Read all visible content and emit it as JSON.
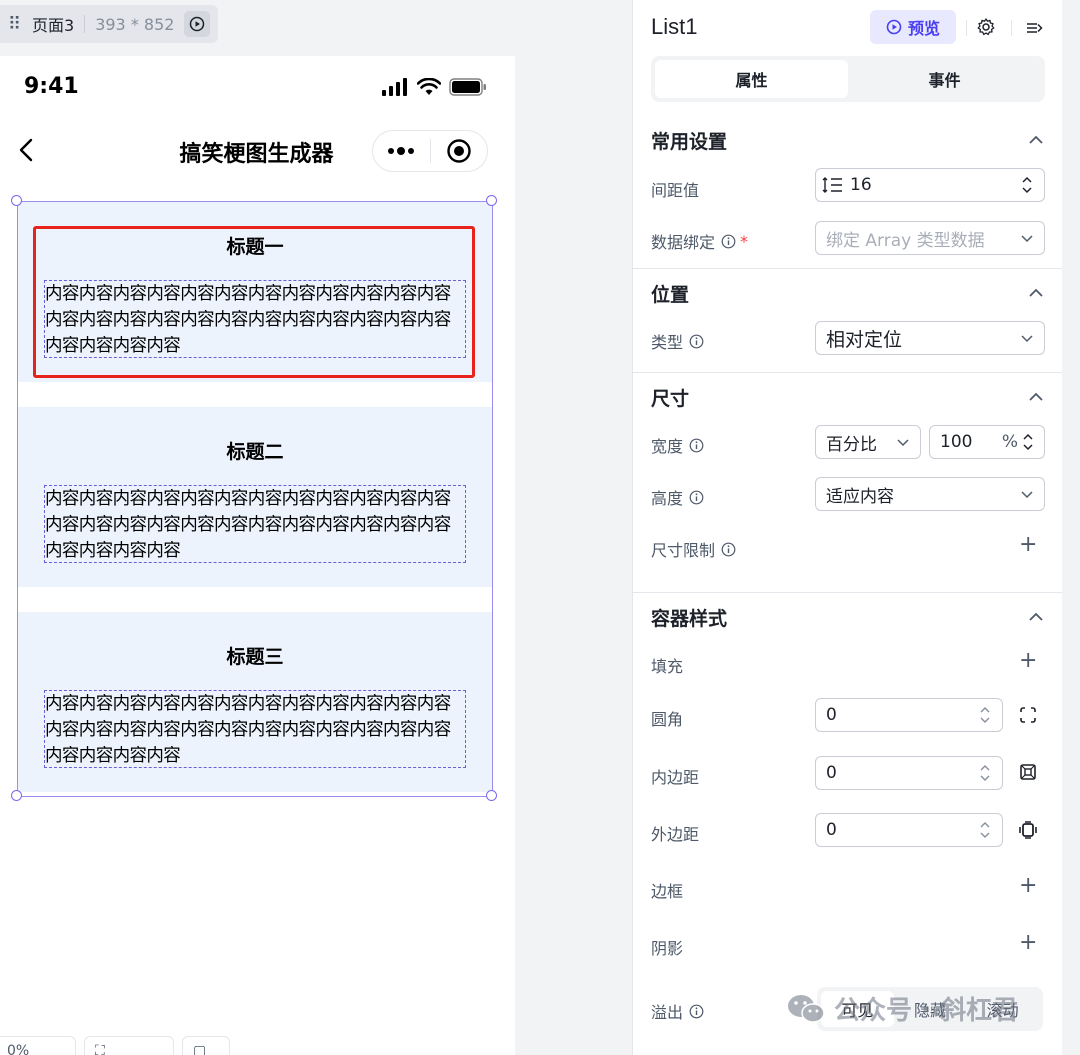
{
  "page_tab": {
    "name": "页面3",
    "dimensions": "393 * 852"
  },
  "status_bar": {
    "time": "9:41"
  },
  "nav": {
    "title": "搞笑梗图生成器"
  },
  "list_items": [
    {
      "title": "标题一",
      "content": "内容内容内容内容内容内容内容内容内容内容内容内容内容内容内容内容内容内容内容内容内容内容内容内容内容内容内容内容"
    },
    {
      "title": "标题二",
      "content": "内容内容内容内容内容内容内容内容内容内容内容内容内容内容内容内容内容内容内容内容内容内容内容内容内容内容内容内容"
    },
    {
      "title": "标题三",
      "content": "内容内容内容内容内容内容内容内容内容内容内容内容内容内容内容内容内容内容内容内容内容内容内容内容内容内容内容内容"
    }
  ],
  "zoom": {
    "value": "0%"
  },
  "panel": {
    "component_name": "List1",
    "preview_label": "预览",
    "tabs": [
      {
        "label": "属性",
        "active": true
      },
      {
        "label": "事件",
        "active": false
      }
    ],
    "sections": {
      "common": {
        "title": "常用设置",
        "spacing_label": "间距值",
        "spacing_value": "16",
        "binding_label": "数据绑定",
        "binding_required": "*",
        "binding_placeholder": "绑定 Array 类型数据"
      },
      "position": {
        "title": "位置",
        "type_label": "类型",
        "type_value": "相对定位"
      },
      "size": {
        "title": "尺寸",
        "width_label": "宽度",
        "width_unit": "百分比",
        "width_value": "100",
        "width_suffix": "%",
        "height_label": "高度",
        "height_value": "适应内容",
        "limit_label": "尺寸限制"
      },
      "container": {
        "title": "容器样式",
        "fill_label": "填充",
        "radius_label": "圆角",
        "radius_value": "0",
        "padding_label": "内边距",
        "padding_value": "0",
        "margin_label": "外边距",
        "margin_value": "0",
        "border_label": "边框",
        "shadow_label": "阴影",
        "overflow_label": "溢出",
        "overflow_options": [
          "可见",
          "隐藏",
          "滚动"
        ]
      }
    }
  },
  "watermark": {
    "text": "公众号 · 斜杠君"
  }
}
